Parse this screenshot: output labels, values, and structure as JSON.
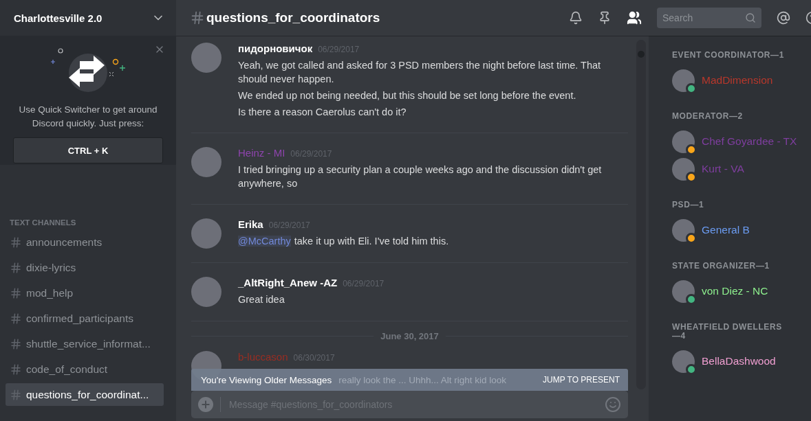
{
  "server": {
    "name": "Charlottesville 2.0"
  },
  "quick_switcher": {
    "text": "Use Quick Switcher to get around Discord quickly. Just press:",
    "shortcut": "CTRL + K"
  },
  "channel_section": {
    "title": "TEXT CHANNELS"
  },
  "channels": [
    {
      "name": "announcements",
      "selected": false
    },
    {
      "name": "dixie-lyrics",
      "selected": false
    },
    {
      "name": "mod_help",
      "selected": false
    },
    {
      "name": "confirmed_participants",
      "selected": false
    },
    {
      "name": "shuttle_service_informat...",
      "selected": false
    },
    {
      "name": "code_of_conduct",
      "selected": false
    },
    {
      "name": "questions_for_coordinat...",
      "selected": true
    }
  ],
  "header": {
    "channel": "questions_for_coordinators",
    "search_placeholder": "Search"
  },
  "feed": [
    {
      "kind": "message",
      "author": "пидорновичок",
      "color": "#ffffff",
      "date": "06/29/2017",
      "lines": [
        {
          "text": "Yeah, we got called and asked for 3 PSD members the night before last time. That should never happen."
        },
        {
          "text": "We ended up not being needed, but this should be set long before the event."
        },
        {
          "text": "Is there a reason Caerolus can't do it?"
        }
      ]
    },
    {
      "kind": "message",
      "author": "Heinz - MI",
      "color": "#8e44ad",
      "date": "06/29/2017",
      "lines": [
        {
          "text": "I tried bringing up a security plan a couple weeks ago and the discussion didn't get anywhere, so"
        }
      ]
    },
    {
      "kind": "message",
      "author": "Erika",
      "color": "#ffffff",
      "date": "06/29/2017",
      "lines": [
        {
          "mention": "@McCarthy",
          "text": "take it up with Eli. I've told him this."
        }
      ]
    },
    {
      "kind": "message",
      "author": "_AltRight_Anew -AZ",
      "color": "#ffffff",
      "date": "06/29/2017",
      "lines": [
        {
          "text": "Great idea"
        }
      ]
    },
    {
      "kind": "divider",
      "label": "June 30, 2017"
    },
    {
      "kind": "message",
      "author": "b-luccason",
      "color": "#992d22",
      "date": "06/30/2017"
    }
  ],
  "older_banner": {
    "label": "You're Viewing Older Messages",
    "covered_text": "really look the ... Uhhh... Alt right kid look",
    "action": "JUMP TO PRESENT"
  },
  "composer": {
    "placeholder": "Message #questions_for_coordinators"
  },
  "member_groups": [
    {
      "title": "EVENT COORDINATOR—1",
      "color": "#b8372b",
      "members": [
        {
          "name": "MadDimension",
          "color": "#43b581"
        }
      ]
    },
    {
      "title": "MODERATOR—2",
      "color": "#7f3e9f",
      "members": [
        {
          "name": "Chef Goyardee - TX",
          "color": "#faa61a"
        },
        {
          "name": "Kurt - VA",
          "color": "#faa61a"
        }
      ]
    },
    {
      "title": "PSD—1",
      "color": "#6b9cf2",
      "members": [
        {
          "name": "General B",
          "color": "#faa61a"
        }
      ]
    },
    {
      "title": "STATE ORGANIZER—1",
      "color": "#8ef08e",
      "members": [
        {
          "name": "von Diez - NC",
          "color": "#43b581"
        }
      ]
    },
    {
      "title": "WHEATFIELD DWELLERS—4",
      "color": "#f19fd2",
      "members": [
        {
          "name": "BellaDashwood",
          "color": "#43b581"
        }
      ]
    }
  ]
}
